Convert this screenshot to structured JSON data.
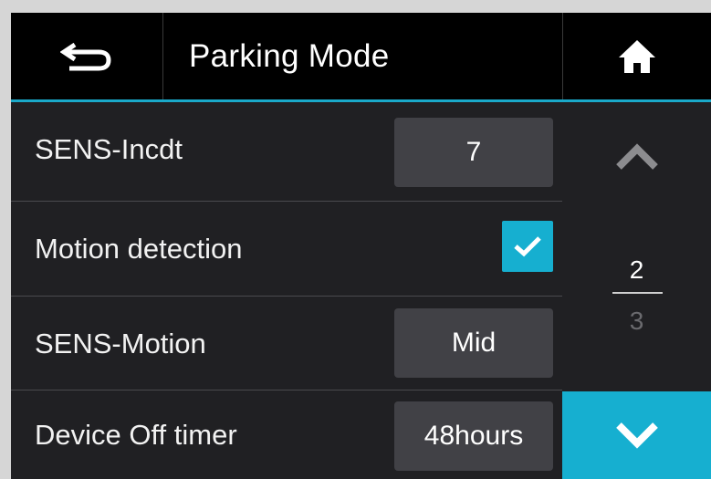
{
  "header": {
    "title": "Parking Mode",
    "back_icon": "back-arrow-icon",
    "home_icon": "home-icon"
  },
  "settings": [
    {
      "label": "SENS-Incdt",
      "type": "value",
      "value": "7"
    },
    {
      "label": "Motion detection",
      "type": "checkbox",
      "checked": true
    },
    {
      "label": "SENS-Motion",
      "type": "value",
      "value": "Mid"
    },
    {
      "label": "Device Off timer",
      "type": "value",
      "value": "48hours"
    }
  ],
  "pagination": {
    "current": "2",
    "total": "3",
    "up_icon": "chevron-up-icon",
    "down_icon": "chevron-down-icon"
  },
  "colors": {
    "accent": "#16afd0",
    "background": "#202023",
    "header": "#000000",
    "button": "#414146"
  }
}
